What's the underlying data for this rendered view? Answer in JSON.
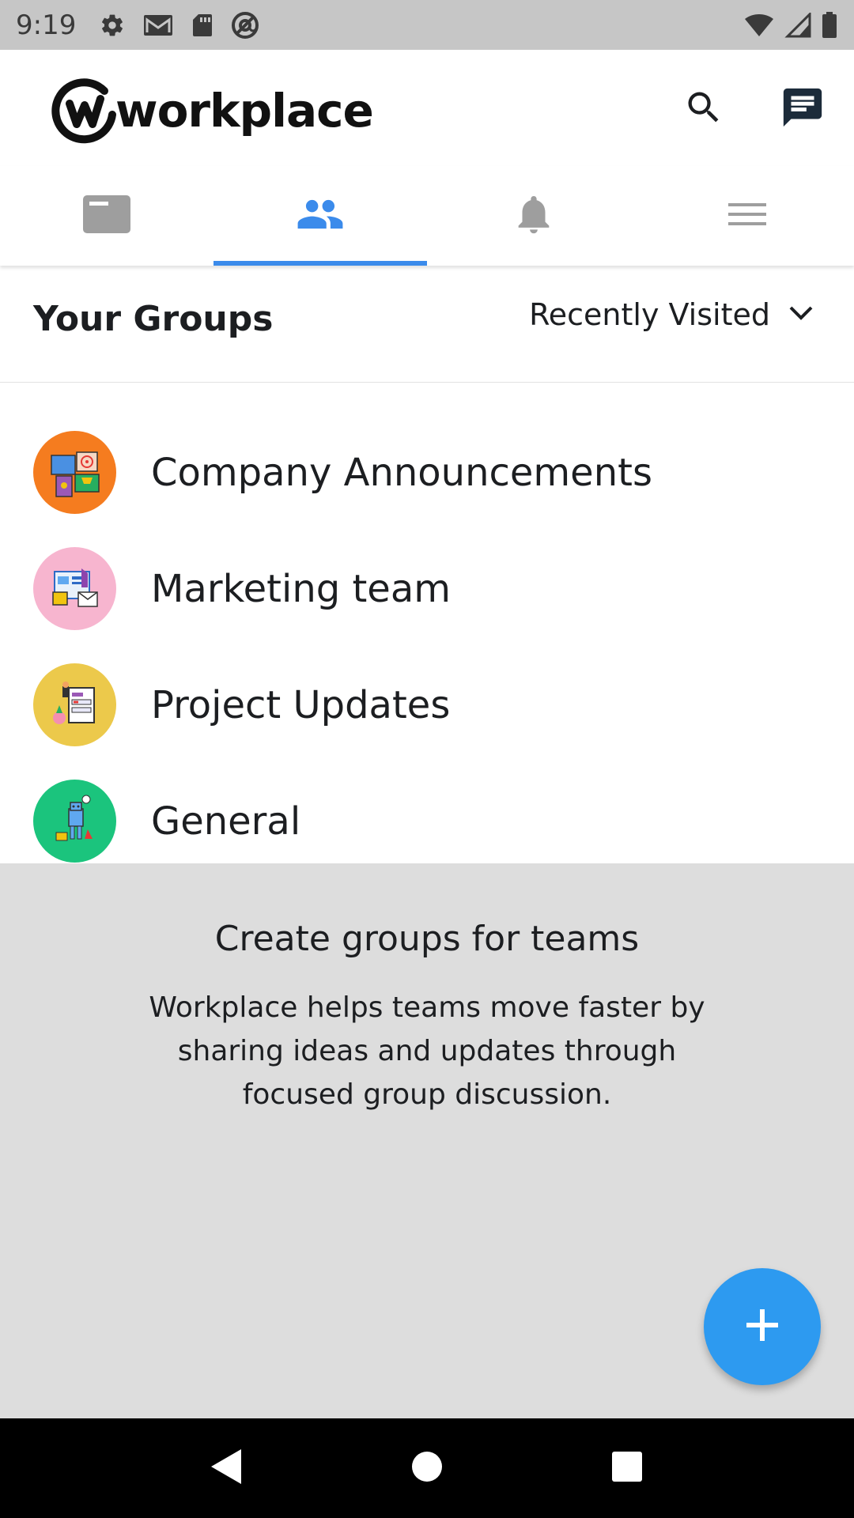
{
  "status_bar": {
    "time": "9:19",
    "left_icons": [
      "gear-icon",
      "gmail-icon",
      "sd-card-icon",
      "at-sign-icon"
    ],
    "right_icons": [
      "wifi-icon",
      "signal-icon",
      "battery-icon"
    ]
  },
  "header": {
    "app_name": "workplace",
    "actions": [
      "search-icon",
      "chat-icon"
    ]
  },
  "tabs": [
    {
      "name": "news-feed",
      "icon": "news-feed-icon",
      "active": false
    },
    {
      "name": "groups",
      "icon": "people-icon",
      "active": true
    },
    {
      "name": "notifications",
      "icon": "bell-icon",
      "active": false
    },
    {
      "name": "menu",
      "icon": "hamburger-menu-icon",
      "active": false
    }
  ],
  "groups_section": {
    "title": "Your Groups",
    "sort_label": "Recently Visited"
  },
  "groups": [
    {
      "name": "Company Announcements",
      "color": "#f57c1f"
    },
    {
      "name": "Marketing team",
      "color": "#f7b5cf"
    },
    {
      "name": "Project Updates",
      "color": "#ecc94b"
    },
    {
      "name": "General",
      "color": "#1bc47d"
    }
  ],
  "promo": {
    "title": "Create groups for teams",
    "body": "Workplace helps teams move faster by sharing ideas and updates through focused group discussion."
  },
  "fab": {
    "icon": "plus-icon",
    "color": "#2d9af0"
  },
  "nav": [
    "back-icon",
    "home-icon",
    "recents-icon"
  ]
}
